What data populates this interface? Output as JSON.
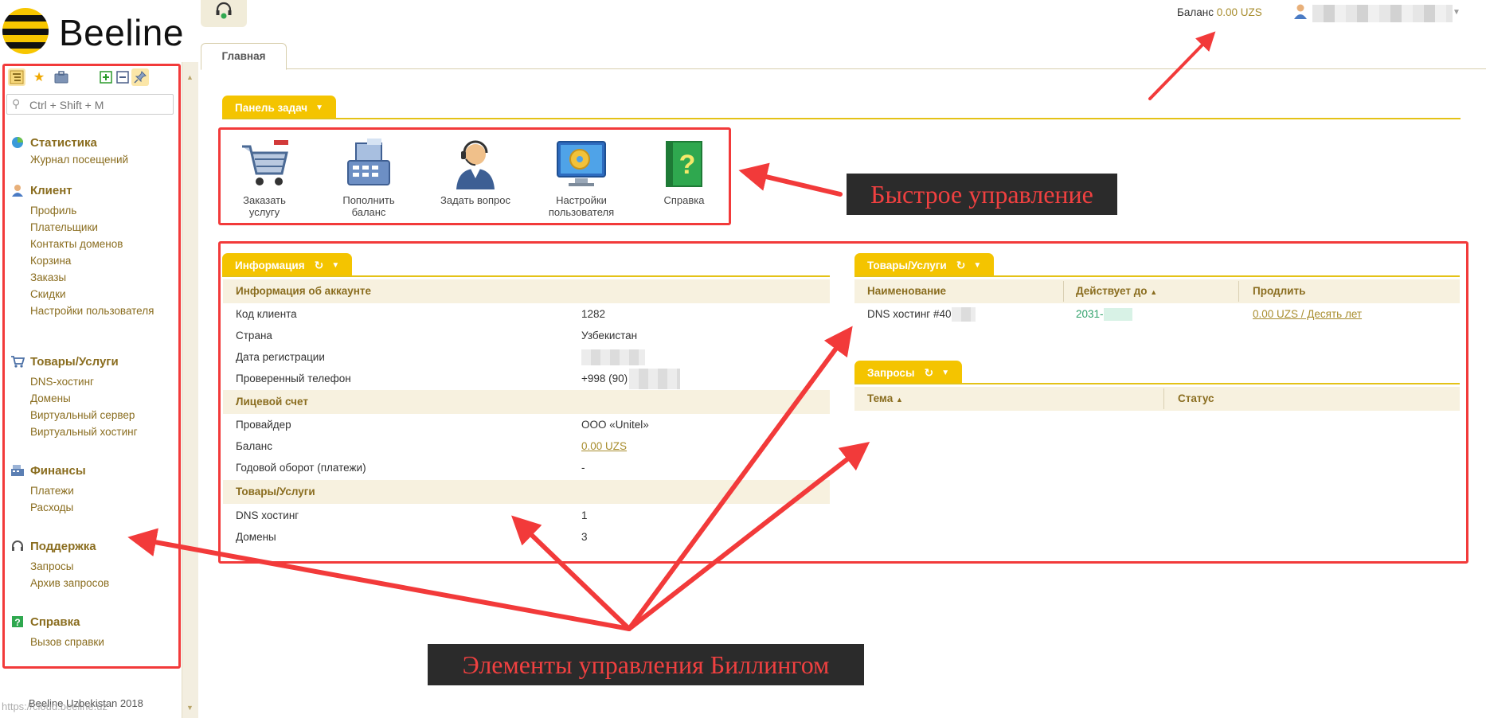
{
  "brand": {
    "name": "Beeline"
  },
  "topbar": {
    "balance_label": "Баланс",
    "balance_value": "0.00 UZS"
  },
  "sidebar": {
    "search_placeholder": "Ctrl + Shift + M",
    "sections": [
      {
        "title": "Статистика",
        "icon": "chart-icon",
        "items": [
          "Журнал посещений"
        ]
      },
      {
        "title": "Клиент",
        "icon": "user-icon",
        "items": [
          "Профиль",
          "Плательщики",
          "Контакты доменов",
          "Корзина",
          "Заказы",
          "Скидки",
          "Настройки пользователя"
        ]
      },
      {
        "title": "Товары/Услуги",
        "icon": "cart-icon",
        "items": [
          "DNS-хостинг",
          "Домены",
          "Виртуальный сервер",
          "Виртуальный хостинг"
        ]
      },
      {
        "title": "Финансы",
        "icon": "cash-register-icon",
        "items": [
          "Платежи",
          "Расходы"
        ]
      },
      {
        "title": "Поддержка",
        "icon": "headset-icon",
        "items": [
          "Запросы",
          "Архив запросов"
        ]
      },
      {
        "title": "Справка",
        "icon": "help-icon",
        "items": [
          "Вызов справки"
        ]
      }
    ],
    "footer_copyright": "Beeline Uzbekistan 2018",
    "footer_url": "https://cloud.beeline.uz"
  },
  "tabs": [
    {
      "label": "Главная"
    }
  ],
  "taskbar": {
    "title": "Панель задач",
    "items": [
      {
        "label": "Заказать услугу",
        "icon": "shopping-cart-icon"
      },
      {
        "label": "Пополнить баланс",
        "icon": "cash-register-icon"
      },
      {
        "label": "Задать вопрос",
        "icon": "support-agent-icon"
      },
      {
        "label": "Настройки пользователя",
        "icon": "settings-monitor-icon"
      },
      {
        "label": "Справка",
        "icon": "help-book-icon"
      }
    ]
  },
  "info": {
    "title": "Информация",
    "groups": [
      {
        "title": "Информация об аккаунте",
        "rows": [
          {
            "label": "Код клиента",
            "value": "1282"
          },
          {
            "label": "Страна",
            "value": "Узбекистан"
          },
          {
            "label": "Дата регистрации",
            "value": ""
          },
          {
            "label": "Проверенный телефон",
            "value": "+998 (90)"
          }
        ]
      },
      {
        "title": "Лицевой счет",
        "rows": [
          {
            "label": "Провайдер",
            "value": "ООО «Unitel»"
          },
          {
            "label": "Баланс",
            "value": "0.00 UZS"
          },
          {
            "label": "Годовой оборот (платежи)",
            "value": "-"
          }
        ]
      },
      {
        "title": "Товары/Услуги",
        "rows": [
          {
            "label": "DNS хостинг",
            "value": "1"
          },
          {
            "label": "Домены",
            "value": "3"
          }
        ]
      }
    ]
  },
  "services": {
    "title": "Товары/Услуги",
    "columns": [
      "Наименование",
      "Действует до",
      "Продлить"
    ],
    "rows": [
      {
        "name": "DNS хостинг #40",
        "expires": "2031-",
        "renew": "0.00 UZS / Десять лет"
      }
    ]
  },
  "requests": {
    "title": "Запросы",
    "columns": [
      "Тема",
      "Статус"
    ]
  },
  "annotations": {
    "quick": "Быстрое управление",
    "billing": "Элементы управления Биллингом"
  },
  "colors": {
    "accent": "#f4c400",
    "annotation_red": "#f23a3a",
    "link": "#a88d2e"
  }
}
